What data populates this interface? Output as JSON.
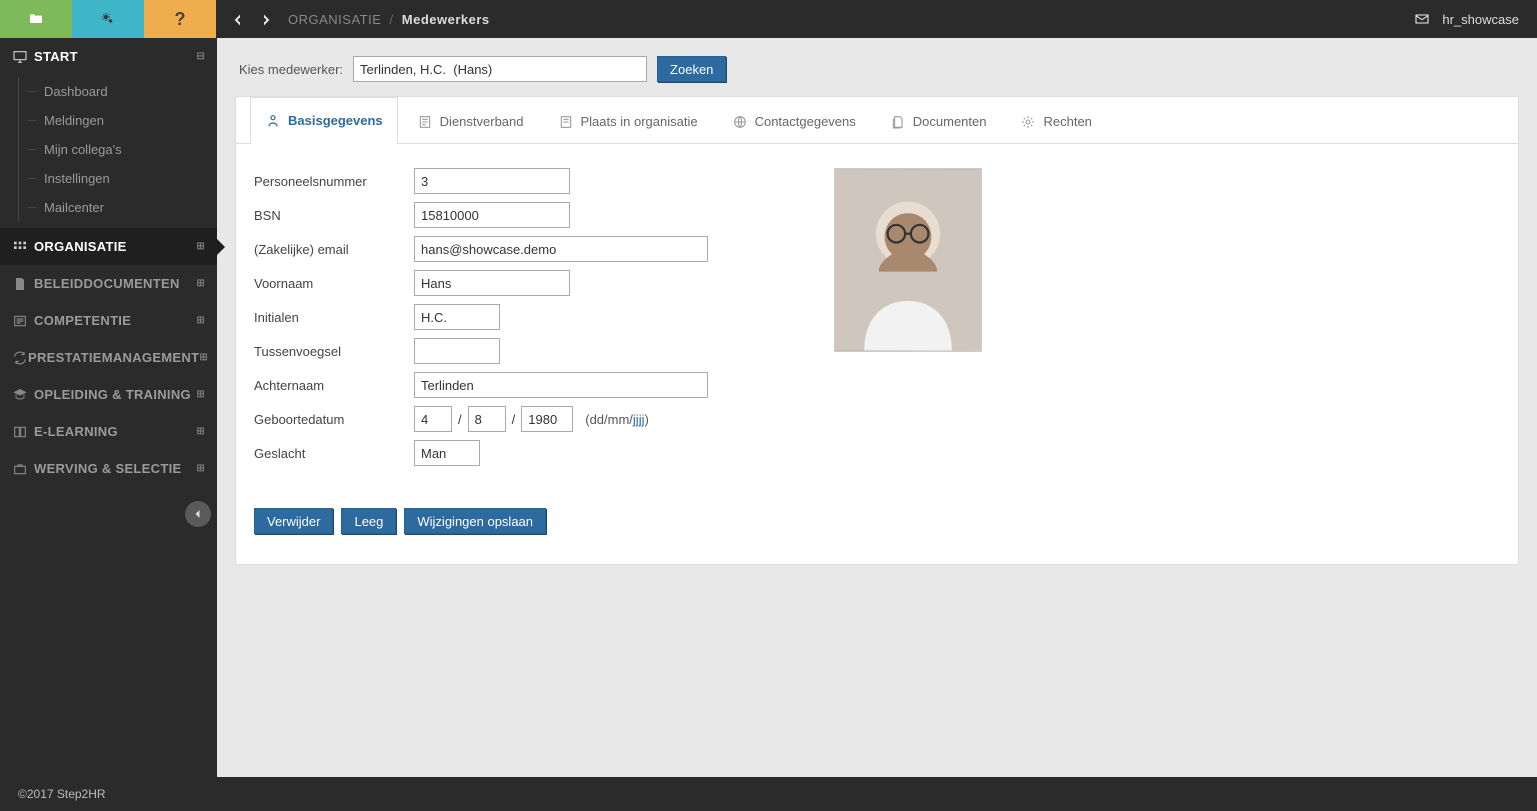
{
  "breadcrumb": {
    "section": "ORGANISATIE",
    "page": "Medewerkers"
  },
  "user": {
    "name": "hr_showcase"
  },
  "sidebar": {
    "start": {
      "label": "START",
      "items": [
        "Dashboard",
        "Meldingen",
        "Mijn collega's",
        "Instellingen",
        "Mailcenter"
      ]
    },
    "sections": [
      {
        "label": "ORGANISATIE",
        "selected": true
      },
      {
        "label": "BELEIDDOCUMENTEN"
      },
      {
        "label": "COMPETENTIE"
      },
      {
        "label": "PRESTATIEMANAGEMENT"
      },
      {
        "label": "OPLEIDING & TRAINING"
      },
      {
        "label": "E-LEARNING"
      },
      {
        "label": "WERVING & SELECTIE"
      }
    ]
  },
  "search": {
    "label": "Kies medewerker:",
    "value": "Terlinden, H.C.  (Hans)",
    "button": "Zoeken"
  },
  "tabs": [
    {
      "label": "Basisgegevens"
    },
    {
      "label": "Dienstverband"
    },
    {
      "label": "Plaats in organisatie"
    },
    {
      "label": "Contactgegevens"
    },
    {
      "label": "Documenten"
    },
    {
      "label": "Rechten"
    }
  ],
  "form": {
    "personeelsnummer": {
      "label": "Personeelsnummer",
      "value": "3"
    },
    "bsn": {
      "label": "BSN",
      "value": "15810000"
    },
    "email": {
      "label": "(Zakelijke) email",
      "value": "hans@showcase.demo"
    },
    "voornaam": {
      "label": "Voornaam",
      "value": "Hans"
    },
    "initialen": {
      "label": "Initialen",
      "value": "H.C."
    },
    "tussenvoegsel": {
      "label": "Tussenvoegsel",
      "value": ""
    },
    "achternaam": {
      "label": "Achternaam",
      "value": "Terlinden"
    },
    "geboortedatum": {
      "label": "Geboortedatum",
      "day": "4",
      "month": "8",
      "year": "1980",
      "hint_prefix": "(dd/mm/",
      "hint_link": "jjjj",
      "hint_suffix": ")"
    },
    "geslacht": {
      "label": "Geslacht",
      "value": "Man"
    }
  },
  "buttons": {
    "delete": "Verwijder",
    "clear": "Leeg",
    "save": "Wijzigingen opslaan"
  },
  "footer": "©2017 Step2HR"
}
